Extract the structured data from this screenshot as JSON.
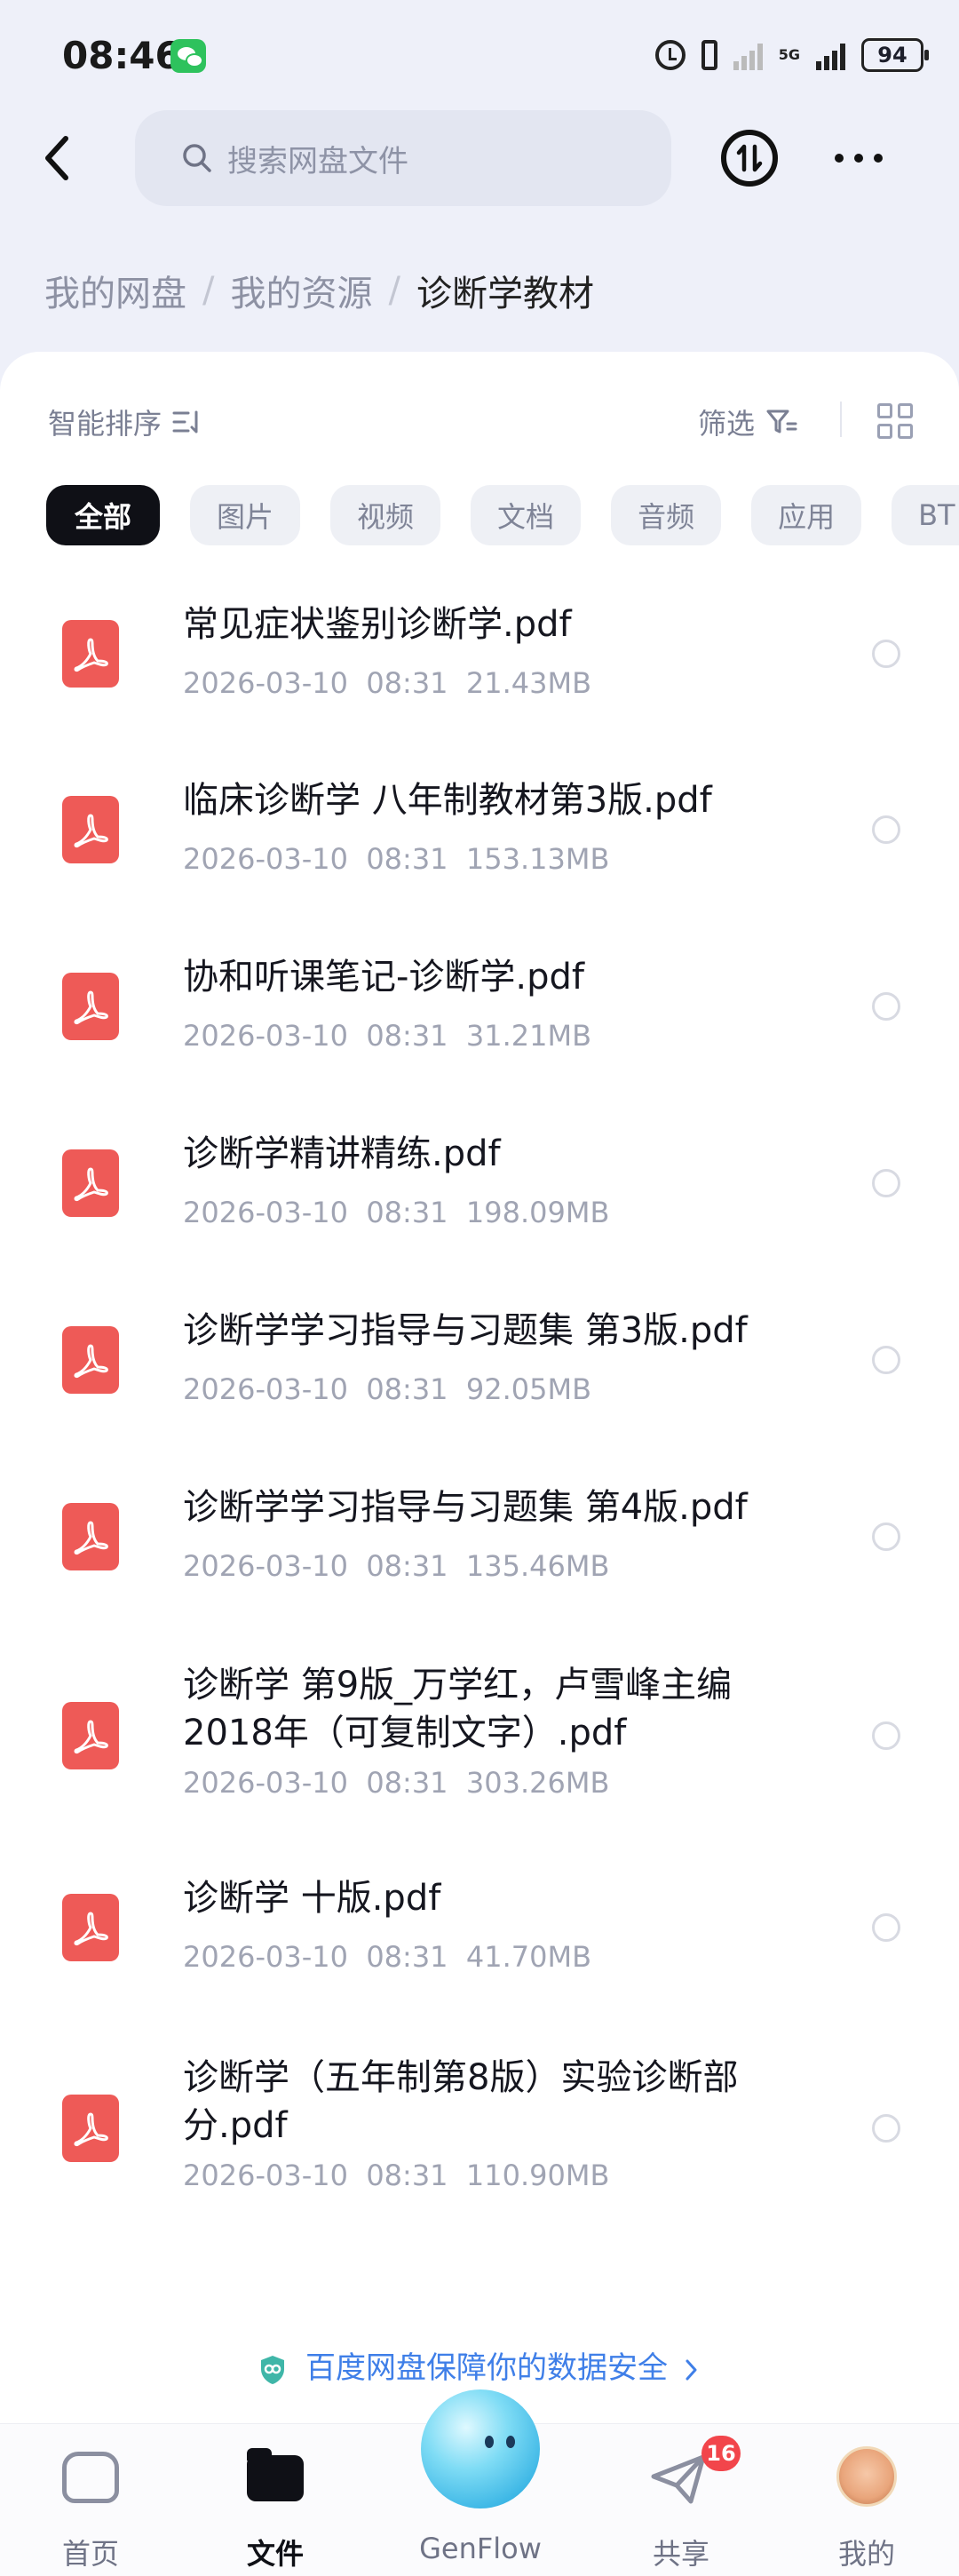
{
  "status_bar": {
    "time": "08:46",
    "network_label": "5G",
    "battery": "94",
    "icons": [
      "wechat-icon",
      "alarm-icon",
      "vibrate-icon",
      "signal-icon",
      "battery-icon"
    ]
  },
  "header": {
    "search_placeholder": "搜索网盘文件",
    "icons": [
      "back-arrow-icon",
      "search-icon",
      "transfer-icon",
      "more-icon"
    ]
  },
  "breadcrumb": {
    "items": [
      "我的网盘",
      "我的资源"
    ],
    "current": "诊断学教材",
    "separator": "/"
  },
  "toolbar": {
    "sort_label": "智能排序",
    "filter_label": "筛选"
  },
  "categories": {
    "items": [
      "全部",
      "图片",
      "视频",
      "文档",
      "音频",
      "应用",
      "BT"
    ],
    "active_index": 0
  },
  "files": [
    {
      "name": "常见症状鉴别诊断学.pdf",
      "date": "2026-03-10  08:31",
      "size": "21.43MB"
    },
    {
      "name": "临床诊断学 八年制教材第3版.pdf",
      "date": "2026-03-10  08:31",
      "size": "153.13MB"
    },
    {
      "name": "协和听课笔记-诊断学.pdf",
      "date": "2026-03-10  08:31",
      "size": "31.21MB"
    },
    {
      "name": "诊断学精讲精练.pdf",
      "date": "2026-03-10  08:31",
      "size": "198.09MB"
    },
    {
      "name": "诊断学学习指导与习题集 第3版.pdf",
      "date": "2026-03-10  08:31",
      "size": "92.05MB"
    },
    {
      "name": "诊断学学习指导与习题集 第4版.pdf",
      "date": "2026-03-10  08:31",
      "size": "135.46MB"
    },
    {
      "name": "诊断学 第9版_万学红，卢雪峰主编2018年（可复制文字）.pdf",
      "date": "2026-03-10  08:31",
      "size": "303.26MB"
    },
    {
      "name": "诊断学 十版.pdf",
      "date": "2026-03-10  08:31",
      "size": "41.70MB"
    },
    {
      "name": "诊断学（五年制第8版）实验诊断部分.pdf",
      "date": "2026-03-10  08:31",
      "size": "110.90MB"
    }
  ],
  "secure_banner": "百度网盘保障你的数据安全",
  "bottom_nav": {
    "items": [
      "首页",
      "文件",
      "GenFlow",
      "共享",
      "我的"
    ],
    "active_index": 1,
    "share_badge": "16"
  },
  "colors": {
    "accent": "#0f1016",
    "pdf_icon": "#ee5a57",
    "banner_text": "#3f7fe8",
    "badge": "#f2454b"
  }
}
